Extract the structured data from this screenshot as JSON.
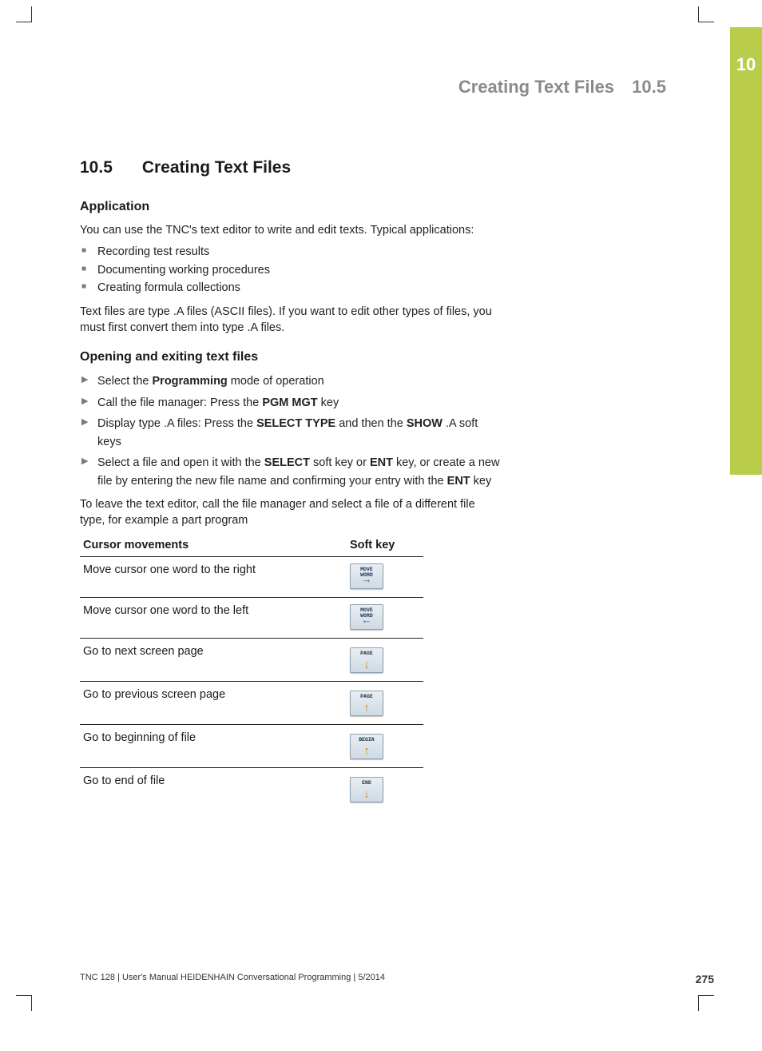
{
  "chapter_tab": "10",
  "header": {
    "title": "Creating Text Files",
    "number": "10.5"
  },
  "section": {
    "number": "10.5",
    "title": "Creating Text Files"
  },
  "application": {
    "heading": "Application",
    "intro": "You can use the TNC's text editor to write and edit texts. Typical applications:",
    "bullets": [
      "Recording test results",
      "Documenting working procedures",
      "Creating formula collections"
    ],
    "note": "Text files are type .A files (ASCII files). If you want to edit other types of files, you must first convert them into type .A files."
  },
  "opening": {
    "heading": "Opening and exiting text files",
    "steps": [
      {
        "pre": "Select the ",
        "b1": "Programming",
        "post": " mode of operation"
      },
      {
        "pre": "Call the file manager: Press the ",
        "b1": "PGM MGT",
        "post": " key"
      },
      {
        "pre": "Display type .A files: Press the ",
        "b1": "SELECT TYPE",
        "mid": " and then the ",
        "b2": "SHOW",
        "post": " .A soft keys"
      },
      {
        "pre": "Select a file and open it with the ",
        "b1": "SELECT",
        "mid": " soft key or ",
        "b2": "ENT",
        "post2": " key, or create a new file by entering the new file name and confirming your entry with the ",
        "b3": "ENT",
        "post": " key"
      }
    ],
    "leave": "To leave the text editor, call the file manager and select a file of a different file type, for example a part program"
  },
  "table": {
    "headers": [
      "Cursor movements",
      "Soft key"
    ],
    "rows": [
      {
        "desc": "Move cursor one word to the right",
        "key_label": "MOVE\nWORD",
        "arrow": "right"
      },
      {
        "desc": "Move cursor one word to the left",
        "key_label": "MOVE\nWORD",
        "arrow": "left"
      },
      {
        "desc": "Go to next screen page",
        "key_label": "PAGE",
        "arrow": "down"
      },
      {
        "desc": "Go to previous screen page",
        "key_label": "PAGE",
        "arrow": "up"
      },
      {
        "desc": "Go to beginning of file",
        "key_label": "BEGIN",
        "arrow": "up"
      },
      {
        "desc": "Go to end of file",
        "key_label": "END",
        "arrow": "down"
      }
    ]
  },
  "footer": {
    "text": "TNC 128 | User's Manual HEIDENHAIN Conversational Programming | 5/2014",
    "page": "275"
  }
}
